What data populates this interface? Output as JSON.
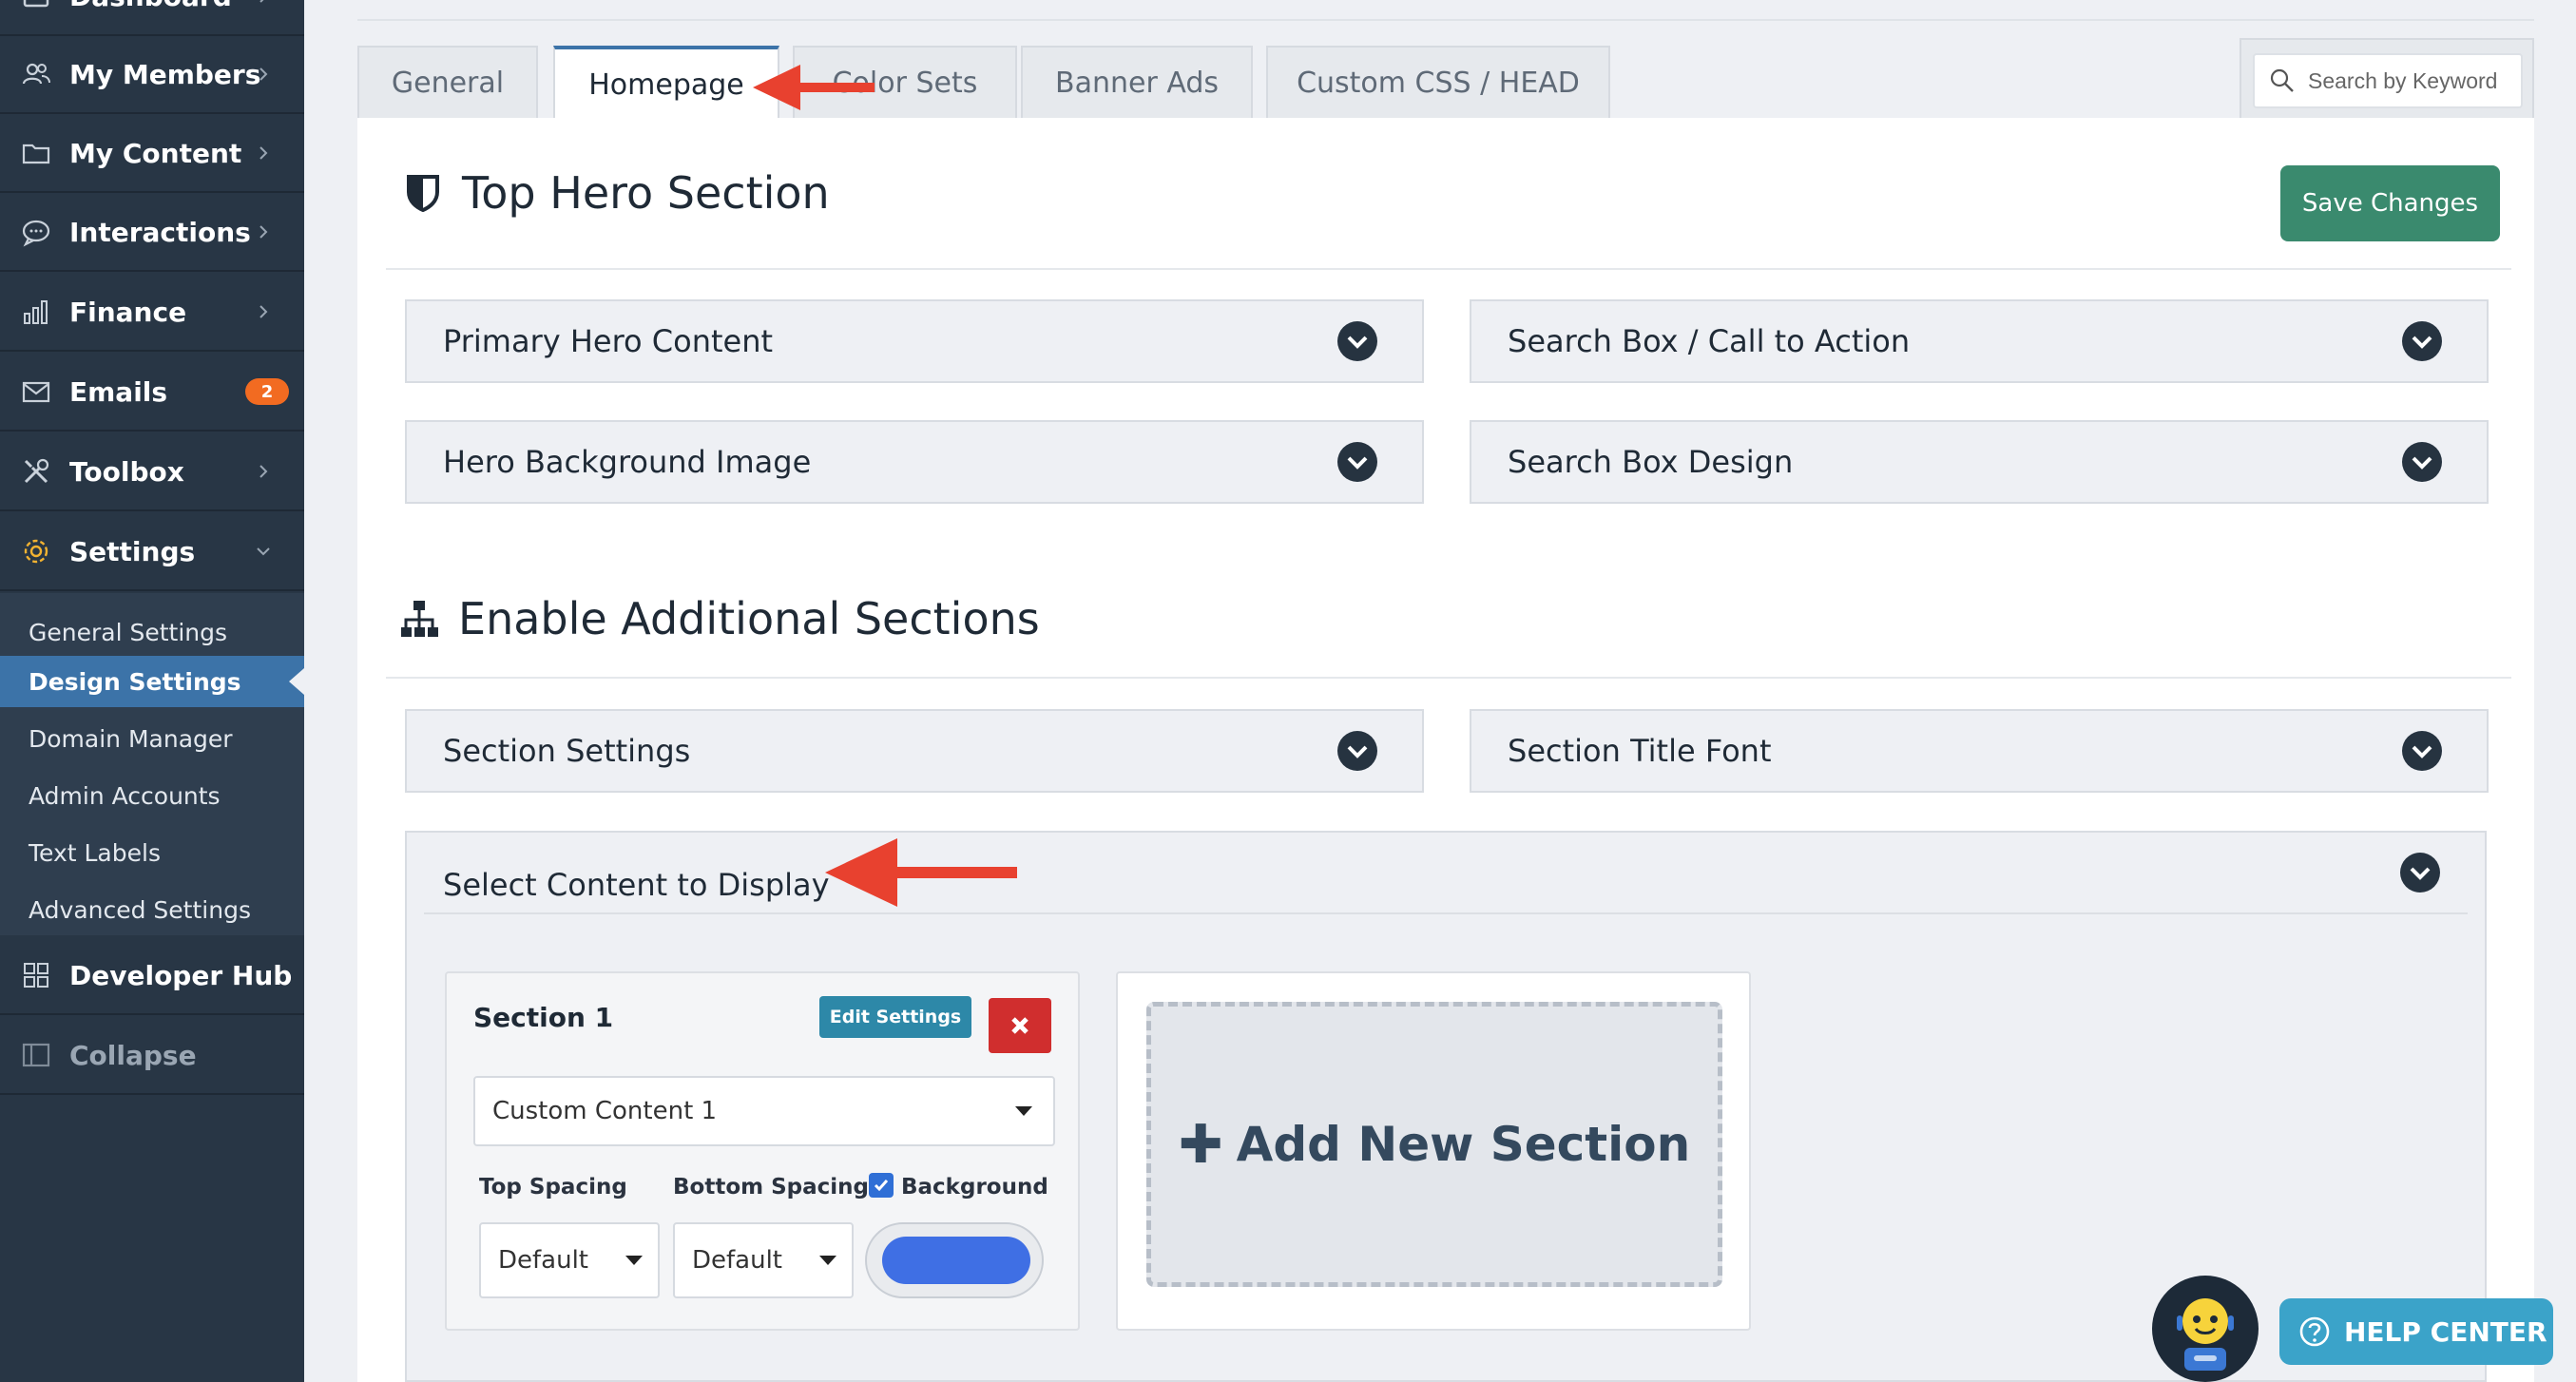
{
  "sidebar": {
    "items": [
      {
        "label": "Dashboard",
        "icon": "dashboard-icon"
      },
      {
        "label": "My Members",
        "icon": "members-icon"
      },
      {
        "label": "My Content",
        "icon": "folder-icon"
      },
      {
        "label": "Interactions",
        "icon": "chat-icon"
      },
      {
        "label": "Finance",
        "icon": "bar-chart-icon"
      },
      {
        "label": "Emails",
        "icon": "mail-icon",
        "badge": "2"
      },
      {
        "label": "Toolbox",
        "icon": "tools-icon"
      },
      {
        "label": "Settings",
        "icon": "gear-icon"
      }
    ],
    "settings_sub": [
      "General Settings",
      "Design Settings",
      "Domain Manager",
      "Admin Accounts",
      "Text Labels",
      "Advanced Settings"
    ],
    "developer_hub": "Developer Hub",
    "collapse": "Collapse"
  },
  "tabs": [
    "General",
    "Homepage",
    "Color Sets",
    "Banner Ads",
    "Custom CSS / HEAD"
  ],
  "search": {
    "placeholder": "Search by Keyword",
    "value": ""
  },
  "hero": {
    "title": "Top Hero Section",
    "save_label": "Save Changes",
    "accordions": [
      "Primary Hero Content",
      "Search Box / Call to Action",
      "Hero Background Image",
      "Search Box Design"
    ]
  },
  "additional": {
    "title": "Enable Additional Sections",
    "accordions": [
      "Section Settings",
      "Section Title Font"
    ],
    "select_content": "Select Content to Display",
    "section_card": {
      "title": "Section 1",
      "edit_label": "Edit Settings",
      "content_value": "Custom Content 1",
      "top_spacing_label": "Top Spacing",
      "bottom_spacing_label": "Bottom Spacing",
      "background_label": "Background",
      "top_spacing_value": "Default",
      "bottom_spacing_value": "Default",
      "background_checked": true,
      "background_color": "#3f6fe4"
    },
    "add_section_label": "Add New Section"
  },
  "help": {
    "label": "HELP CENTER"
  },
  "colors": {
    "sidebar_bg": "#283645",
    "accent": "#3c73a8",
    "save_green": "#3a8a6e",
    "delete_red": "#d02e2e",
    "badge_orange": "#f26b21",
    "annotation_arrow": "#e8412f"
  }
}
